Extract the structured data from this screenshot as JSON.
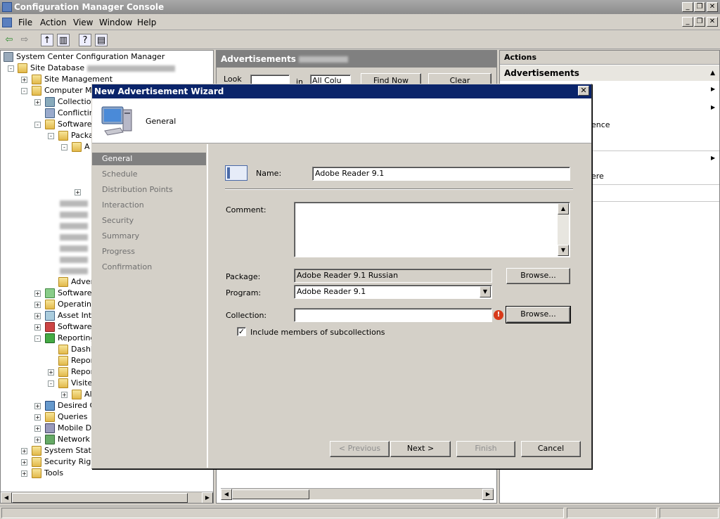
{
  "window": {
    "title": "Configuration Manager Console"
  },
  "menu": [
    "File",
    "Action",
    "View",
    "Window",
    "Help"
  ],
  "tree": {
    "root": "System Center Configuration Manager",
    "site_db": "Site Database",
    "items": [
      {
        "label": "Site Management"
      },
      {
        "label": "Computer Ma"
      },
      {
        "label": "Collection"
      },
      {
        "label": "Conflicting"
      },
      {
        "label": "Software"
      },
      {
        "label": "Packa"
      },
      {
        "label": "A"
      },
      {
        "label": "Adver"
      },
      {
        "label": "Software"
      },
      {
        "label": "Operating"
      },
      {
        "label": "Asset Inte"
      },
      {
        "label": "Software"
      },
      {
        "label": "Reporting"
      },
      {
        "label": "Dashb"
      },
      {
        "label": "Repor"
      },
      {
        "label": "Repor"
      },
      {
        "label": "Visited"
      },
      {
        "label": "Al"
      },
      {
        "label": "Desired C"
      },
      {
        "label": "Queries"
      },
      {
        "label": "Mobile De"
      },
      {
        "label": "Network A"
      },
      {
        "label": "System Status"
      },
      {
        "label": "Security Right"
      },
      {
        "label": "Tools"
      }
    ]
  },
  "middle": {
    "header": "Advertisements",
    "look_label": "Look",
    "in_label": "in",
    "column_value": "All Colu",
    "find_now": "Find Now",
    "clear": "Clear"
  },
  "actions": {
    "header": "Actions",
    "section": "Advertisements",
    "item1": "ence",
    "item2": "ere"
  },
  "wizard": {
    "title": "New Advertisement Wizard",
    "header_title": "General",
    "nav": [
      "General",
      "Schedule",
      "Distribution Points",
      "Interaction",
      "Security",
      "Summary",
      "Progress",
      "Confirmation"
    ],
    "name_label": "Name:",
    "name_value": "Adobe Reader 9.1",
    "comment_label": "Comment:",
    "package_label": "Package:",
    "package_value": "Adobe Reader 9.1 Russian",
    "program_label": "Program:",
    "program_value": "Adobe Reader 9.1",
    "collection_label": "Collection:",
    "collection_value": "",
    "browse": "Browse...",
    "include_subcollections": "Include members of subcollections",
    "include_checked": true,
    "buttons": {
      "previous": "< Previous",
      "next": "Next >",
      "finish": "Finish",
      "cancel": "Cancel"
    }
  }
}
